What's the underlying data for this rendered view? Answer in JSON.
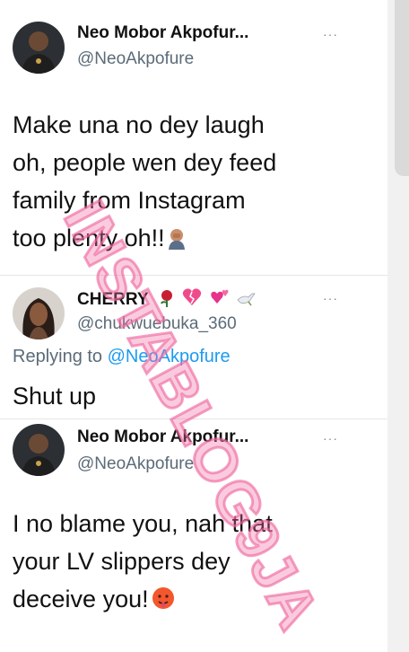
{
  "tweets": [
    {
      "name": "Neo Mobor Akpofur...",
      "handle": "@NeoAkpofure",
      "lines": [
        "Make una no dey laugh",
        "oh, people wen dey feed",
        "family from Instagram",
        "too plenty oh!!"
      ]
    },
    {
      "name": "CHERRY",
      "handle": "@chukwuebuka_360",
      "replying_prefix": "Replying to ",
      "replying_to": "@NeoAkpofure",
      "lines": [
        "Shut up"
      ]
    },
    {
      "name": "Neo Mobor Akpofur...",
      "handle": "@NeoAkpofure",
      "lines": [
        "I no blame you, nah that",
        "your LV slippers dey",
        "deceive you!"
      ]
    }
  ],
  "more_glyph": "···",
  "watermark": {
    "text": "INSTABLOG9JA",
    "color": "#f06aa0"
  },
  "colors": {
    "link": "#1d9bf0",
    "secondary": "#5b6b78"
  }
}
